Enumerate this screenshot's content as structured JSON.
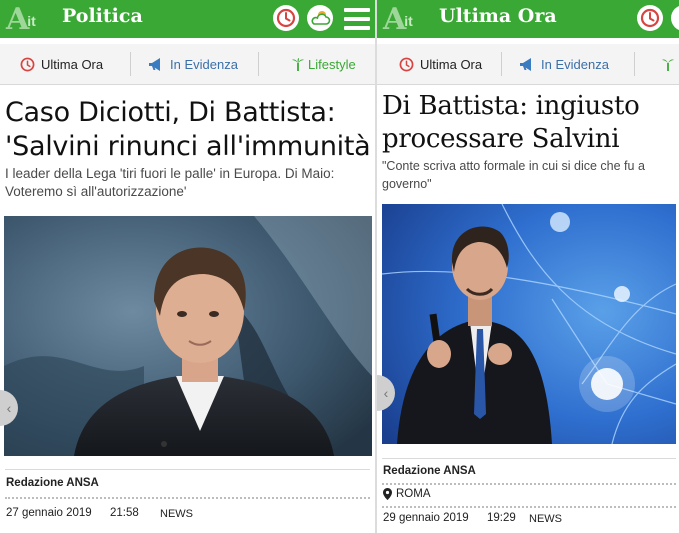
{
  "left": {
    "logo": {
      "mark": "A",
      "it": "it"
    },
    "section_title": "Politica",
    "tabs": {
      "ultima_ora": "Ultima Ora",
      "in_evidenza": "In Evidenza",
      "lifestyle": "Lifestyle"
    },
    "headline_line1": "Caso Diciotti, Di Battista:",
    "headline_line2": "'Salvini rinunci all'immunità",
    "subtitle_line1": "I leader della Lega 'tiri fuori le palle' in Europa. Di Maio:",
    "subtitle_line2": "Voteremo sì all'autorizzazione'",
    "author": "Redazione ANSA",
    "date": "27 gennaio 2019",
    "time": "21:58",
    "category": "NEWS"
  },
  "right": {
    "logo": {
      "mark": "A",
      "it": "it"
    },
    "section_title": "Ultima Ora",
    "tabs": {
      "ultima_ora": "Ultima Ora",
      "in_evidenza": "In Evidenza"
    },
    "headline_line1": "Di Battista: ingiusto",
    "headline_line2": "processare Salvini",
    "subtitle_line1": "\"Conte scriva atto formale in cui si dice che fu a",
    "subtitle_line2": "governo\"",
    "author": "Redazione ANSA",
    "location": "ROMA",
    "date": "29 gennaio 2019",
    "time": "19:29",
    "category": "NEWS"
  },
  "colors": {
    "brand_green": "#3aa835",
    "accent_red": "#d64541",
    "accent_blue": "#3b7bbf",
    "lifestyle_green": "#3aa835"
  },
  "icons": [
    "clock-icon",
    "weather-icon",
    "menu-icon",
    "megaphone-icon",
    "palm-icon",
    "chevron-left-icon",
    "location-pin-icon"
  ]
}
